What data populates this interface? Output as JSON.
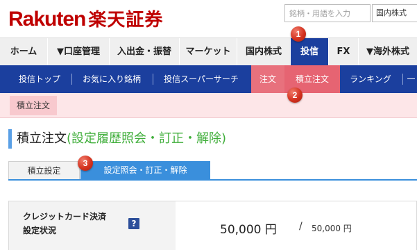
{
  "brand": {
    "latin": "Rakuten",
    "cjk": "楽天証券"
  },
  "search": {
    "placeholder": "銘柄・用語を入力",
    "scope": "国内株式"
  },
  "main_nav": [
    {
      "label": "ホーム"
    },
    {
      "label": "▼口座管理"
    },
    {
      "label": "入出金・振替"
    },
    {
      "label": "マーケット"
    },
    {
      "label": "国内株式"
    },
    {
      "label": "投信",
      "active": true
    },
    {
      "label": "FX"
    },
    {
      "label": "▼海外株式"
    }
  ],
  "sub_nav": [
    {
      "label": "投信トップ"
    },
    {
      "label": "お気に入り銘柄"
    },
    {
      "label": "投信スーパーサーチ"
    },
    {
      "label": "注文"
    },
    {
      "label": "積立注文",
      "active": true
    },
    {
      "label": "ランキング"
    },
    {
      "label": "一"
    }
  ],
  "breadcrumb": {
    "current": "積立注文"
  },
  "page": {
    "title": "積立注文",
    "subtitle": "(設定履歴照会・訂正・解除)"
  },
  "tabs": [
    {
      "label": "積立設定"
    },
    {
      "label": "設定照会・訂正・解除",
      "active": true
    }
  ],
  "credit_card": {
    "label_line1": "クレジットカード決済",
    "label_line2": "設定状況",
    "help": "?",
    "amount": "50,000 円",
    "separator": "/",
    "limit": "50,000 円"
  },
  "callouts": [
    "1",
    "2",
    "3"
  ],
  "colors": {
    "brand": "#bf0000",
    "nav_active": "#1b3f9e",
    "tab_active": "#3a8fdc",
    "accent_green": "#3fae3a"
  }
}
